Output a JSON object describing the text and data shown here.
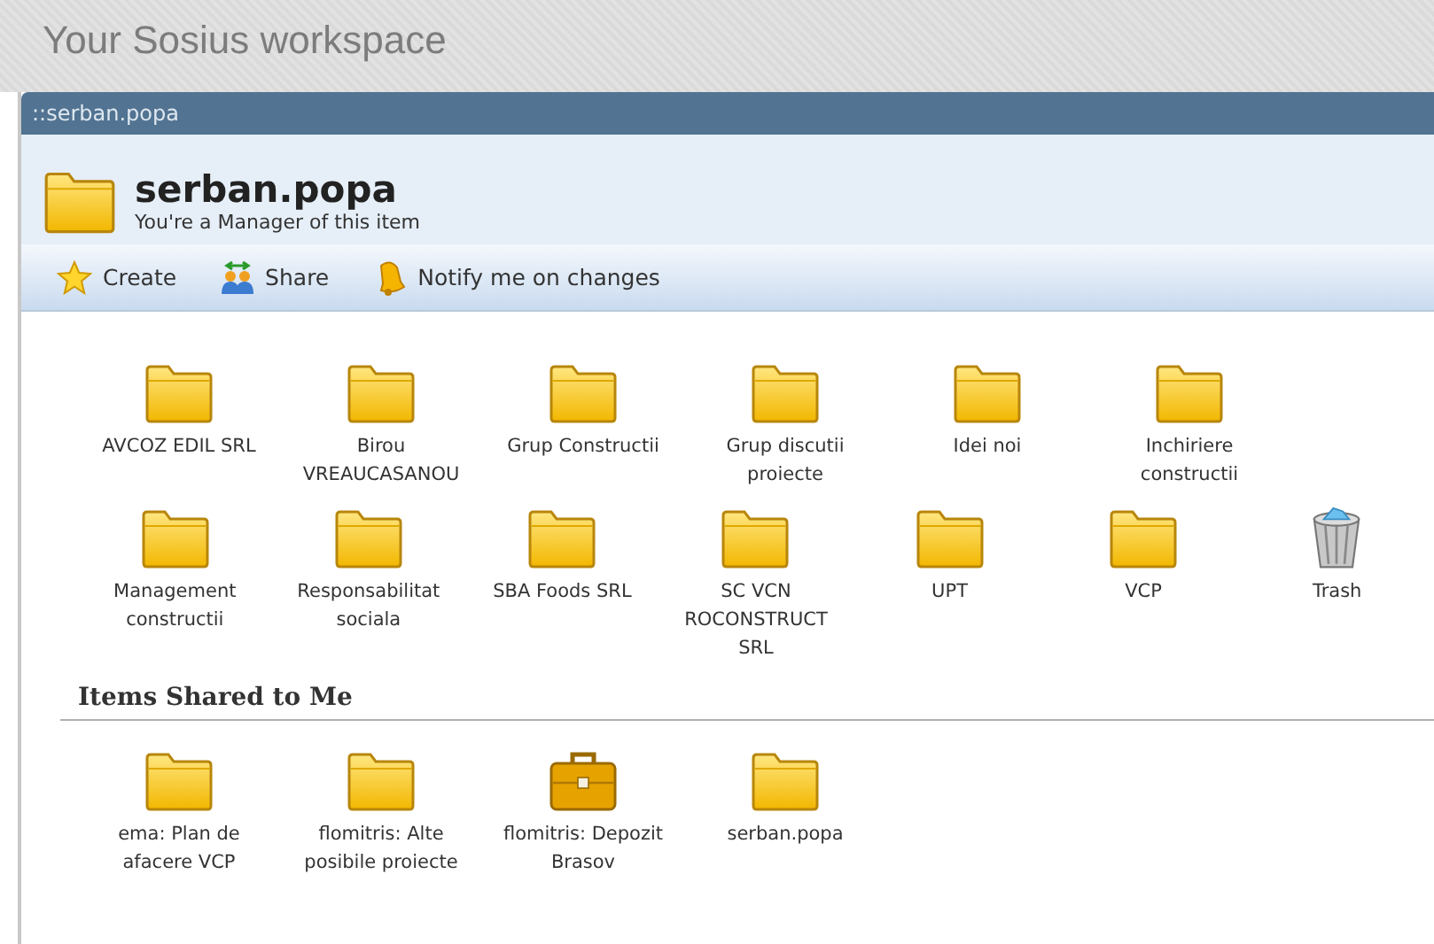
{
  "page_title": "Your Sosius workspace",
  "breadcrumb": "::serban.popa",
  "header": {
    "title": "serban.popa",
    "subtitle": "You're a Manager of this item"
  },
  "toolbar": [
    {
      "kind": "create",
      "label": "Create"
    },
    {
      "kind": "share",
      "label": "Share"
    },
    {
      "kind": "notify",
      "label": "Notify me on changes"
    }
  ],
  "item_rows": [
    [
      {
        "kind": "folder",
        "label": "AVCOZ EDIL SRL"
      },
      {
        "kind": "folder",
        "label": "Birou VREAUCASANOU"
      },
      {
        "kind": "folder",
        "label": "Grup Constructii"
      },
      {
        "kind": "folder",
        "label": "Grup discutii proiecte"
      },
      {
        "kind": "folder",
        "label": "Idei noi"
      },
      {
        "kind": "folder",
        "label": "Inchiriere constructii"
      }
    ],
    [
      {
        "kind": "folder",
        "label": "Management constructii"
      },
      {
        "kind": "folder",
        "label": "Responsabilitat sociala"
      },
      {
        "kind": "folder",
        "label": "SBA Foods SRL"
      },
      {
        "kind": "folder",
        "label": "SC VCN ROCONSTRUCT SRL"
      },
      {
        "kind": "folder",
        "label": "UPT"
      },
      {
        "kind": "folder",
        "label": "VCP"
      },
      {
        "kind": "trash",
        "label": "Trash"
      }
    ]
  ],
  "shared": {
    "heading": "Items Shared to Me",
    "items": [
      {
        "kind": "folder",
        "label": "ema: Plan de afacere VCP"
      },
      {
        "kind": "folder",
        "label": "flomitris: Alte posibile proiecte"
      },
      {
        "kind": "briefcase",
        "label": "flomitris: Depozit Brasov"
      },
      {
        "kind": "folder",
        "label": "serban.popa"
      }
    ]
  }
}
